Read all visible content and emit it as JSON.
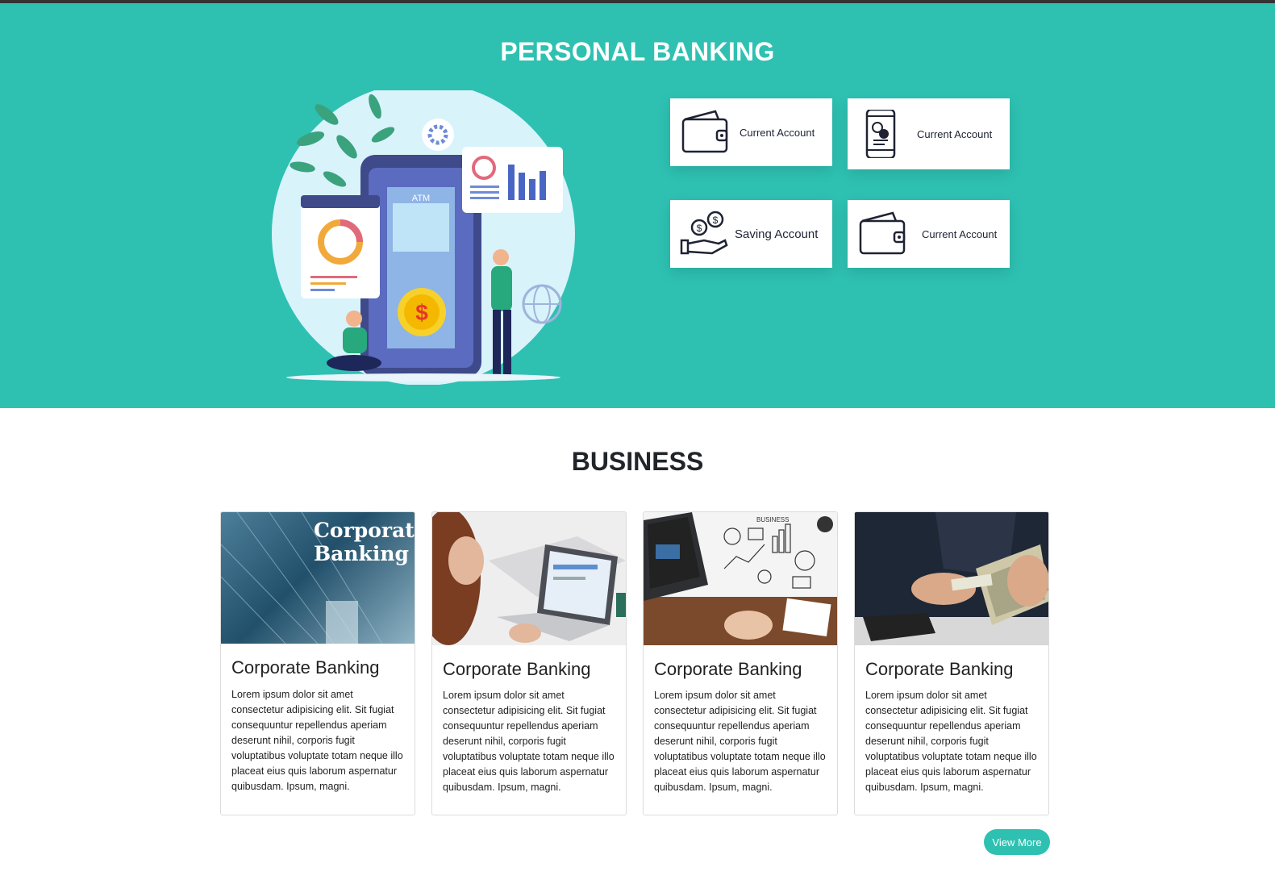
{
  "personal": {
    "title": "PERSONAL BANKING",
    "accounts": [
      {
        "label": "Current Account",
        "icon": "wallet-icon"
      },
      {
        "label": "Current Account",
        "icon": "mobile-exchange-icon"
      },
      {
        "label": "Saving Account",
        "icon": "hand-coins-icon"
      },
      {
        "label": "Current Account",
        "icon": "wallet-icon"
      }
    ],
    "illustration": {
      "atm_label": "ATM"
    }
  },
  "business": {
    "title": "BUSINESS",
    "cards": [
      {
        "title": "Corporate Banking",
        "image_text": "Corporate Banking",
        "body": "Lorem ipsum dolor sit amet consectetur adipisicing elit. Sit fugiat consequuntur repellendus aperiam deserunt nihil, corporis fugit voluptatibus voluptate totam neque illo placeat eius quis laborum aspernatur quibusdam. Ipsum, magni."
      },
      {
        "title": "Corporate Banking",
        "body": "Lorem ipsum dolor sit amet consectetur adipisicing elit. Sit fugiat consequuntur repellendus aperiam deserunt nihil, corporis fugit voluptatibus voluptate totam neque illo placeat eius quis laborum aspernatur quibusdam. Ipsum, magni."
      },
      {
        "title": "Corporate Banking",
        "image_text": "BUSINESS",
        "body": "Lorem ipsum dolor sit amet consectetur adipisicing elit. Sit fugiat consequuntur repellendus aperiam deserunt nihil, corporis fugit voluptatibus voluptate totam neque illo placeat eius quis laborum aspernatur quibusdam. Ipsum, magni."
      },
      {
        "title": "Corporate Banking",
        "body": "Lorem ipsum dolor sit amet consectetur adipisicing elit. Sit fugiat consequuntur repellendus aperiam deserunt nihil, corporis fugit voluptatibus voluptate totam neque illo placeat eius quis laborum aspernatur quibusdam. Ipsum, magni."
      }
    ],
    "view_more": "View More"
  },
  "colors": {
    "accent": "#2ec1b2",
    "dark_icon": "#1e2233"
  }
}
